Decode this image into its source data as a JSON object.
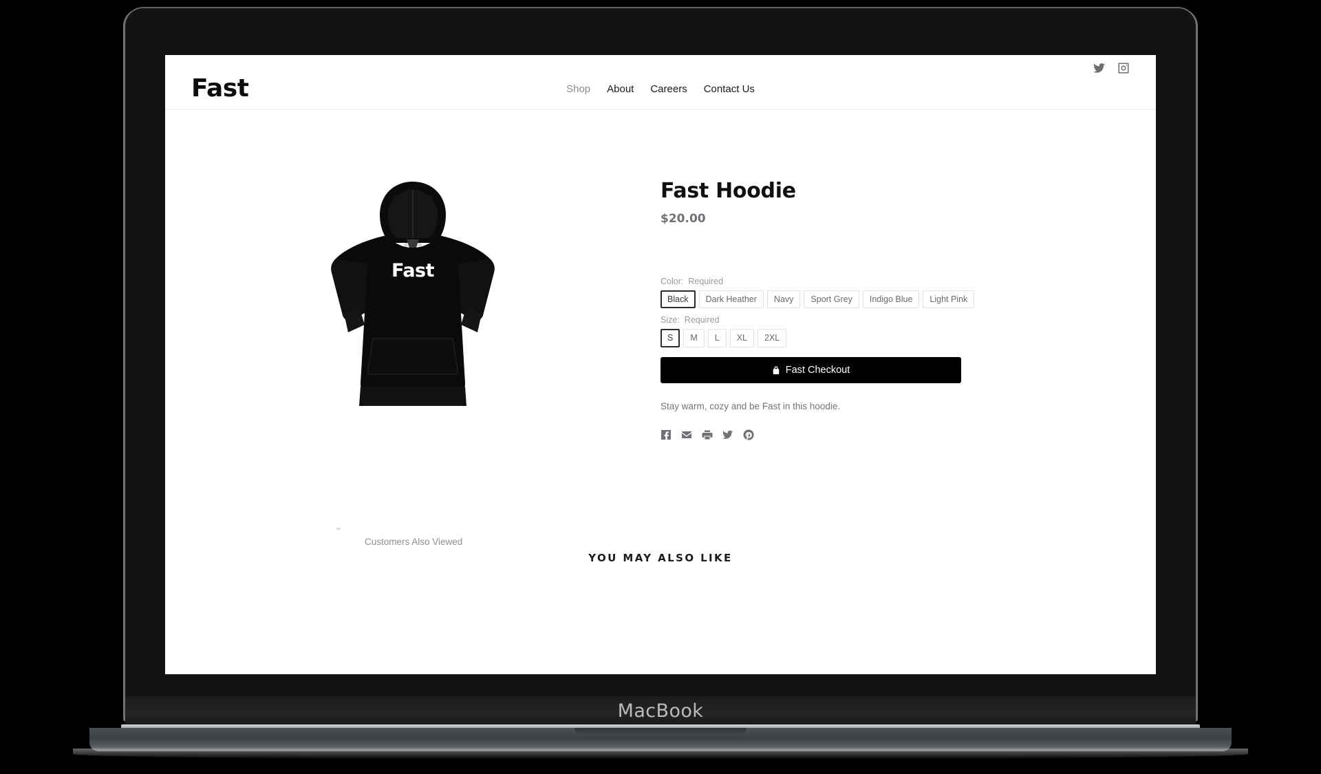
{
  "device": {
    "wordmark": "MacBook"
  },
  "header": {
    "brand": "Fast",
    "nav": [
      {
        "label": "Shop",
        "muted": true
      },
      {
        "label": "About",
        "muted": false
      },
      {
        "label": "Careers",
        "muted": false
      },
      {
        "label": "Contact Us",
        "muted": false
      }
    ],
    "social": [
      {
        "name": "twitter-icon"
      },
      {
        "name": "instagram-icon"
      }
    ]
  },
  "product": {
    "title": "Fast Hoodie",
    "price": "$20.00",
    "image_wordmark": "Fast",
    "description": "Stay warm, cozy and be Fast in this hoodie.",
    "color_option": {
      "label": "Color:",
      "required": "Required",
      "selected": "Black",
      "values": [
        "Black",
        "Dark Heather",
        "Navy",
        "Sport Grey",
        "Indigo Blue",
        "Light Pink"
      ]
    },
    "size_option": {
      "label": "Size:",
      "required": "Required",
      "selected": "S",
      "values": [
        "S",
        "M",
        "L",
        "XL",
        "2XL"
      ]
    },
    "checkout_label": "Fast Checkout",
    "checkout_icon": "lock-icon",
    "share_icons": [
      "facebook-icon",
      "email-icon",
      "print-icon",
      "twitter-icon",
      "pinterest-icon"
    ]
  },
  "sections": {
    "customers_also_viewed": "Customers Also Viewed",
    "you_may_also_like": "YOU MAY ALSO LIKE"
  },
  "colors": {
    "accent": "#000000",
    "muted_text": "#8c8c8c",
    "price_text": "#6c727a",
    "border": "#e2e2e2"
  }
}
